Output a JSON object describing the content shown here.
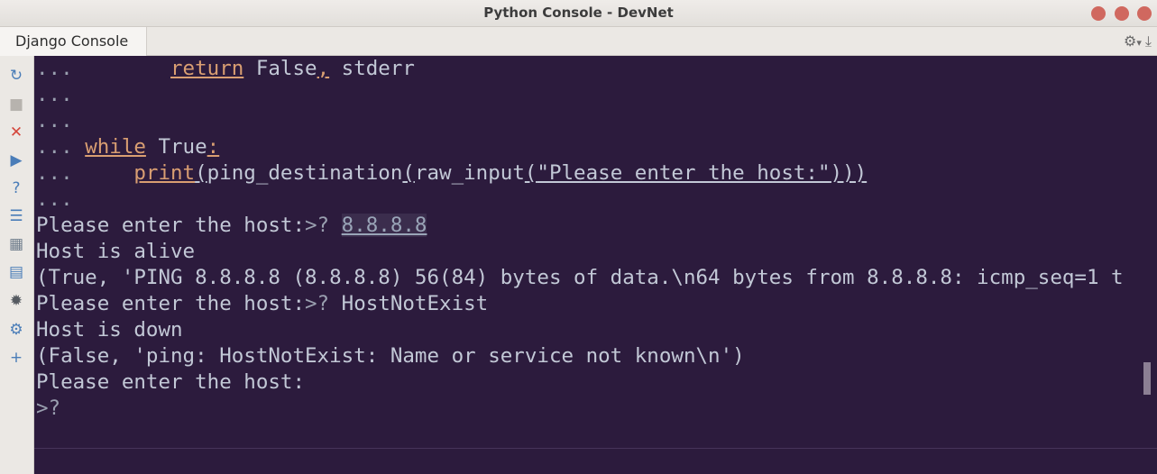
{
  "window": {
    "title": "Python Console - DevNet"
  },
  "tabbar": {
    "active_tab": "Django Console",
    "gear_icon": "⚙",
    "chevron_icon": "▾",
    "pin_icon": "⤓"
  },
  "toolbar": {
    "icons": [
      {
        "name": "rerun-icon",
        "glyph": "↻",
        "color": "#4a7db8"
      },
      {
        "name": "stop-icon",
        "glyph": "■",
        "color": "#b7b3ae"
      },
      {
        "name": "close-icon",
        "glyph": "✕",
        "color": "#d4463b"
      },
      {
        "name": "run-icon",
        "glyph": "▶",
        "color": "#4a7db8"
      },
      {
        "name": "help-icon",
        "glyph": "?",
        "color": "#4a7db8"
      },
      {
        "name": "settings-list-icon",
        "glyph": "☰",
        "color": "#4a7db8"
      },
      {
        "name": "variables-icon",
        "glyph": "▦",
        "color": "#6f7d8c"
      },
      {
        "name": "history-icon",
        "glyph": "▤",
        "color": "#4a7db8"
      },
      {
        "name": "debug-icon",
        "glyph": "✹",
        "color": "#555a60"
      },
      {
        "name": "gear-icon",
        "glyph": "⚙",
        "color": "#4a7db8"
      },
      {
        "name": "add-icon",
        "glyph": "+",
        "color": "#4a7db8"
      }
    ]
  },
  "console": {
    "line1": {
      "dots": "...",
      "indent": "        ",
      "kw": "return",
      "mid": " False",
      "comma": ",",
      "rest": " stderr"
    },
    "line2": {
      "dots": "..."
    },
    "line3": {
      "dots": "..."
    },
    "line4": {
      "dots": "...",
      "space": " ",
      "kw": "while",
      "mid": " True",
      "colon": ":"
    },
    "line5": {
      "dots": "...",
      "indent": "     ",
      "kw": "print",
      "p1": "(",
      "a": "ping_destination",
      "p2": "(",
      "b": "raw_input",
      "p3": "(",
      "s": "\"Please enter the host:\"",
      "close": ")))"
    },
    "line6": {
      "dots": "..."
    },
    "line7": {
      "label": "Please enter the host:",
      "marker": ">?",
      "space": " ",
      "input": "8.8.8.8"
    },
    "line8": {
      "text": "Host is alive"
    },
    "line9": {
      "text": "(True, 'PING 8.8.8.8 (8.8.8.8) 56(84) bytes of data.\\n64 bytes from 8.8.8.8: icmp_seq=1 t"
    },
    "line10": {
      "label": "Please enter the host:",
      "marker": ">?",
      "input": " HostNotExist"
    },
    "line11": {
      "text": "Host is down"
    },
    "line12": {
      "text": "(False, 'ping: HostNotExist: Name or service not known\\n')"
    },
    "line13": {
      "text": "Please enter the host:"
    },
    "line14": {
      "marker": ">?"
    }
  }
}
